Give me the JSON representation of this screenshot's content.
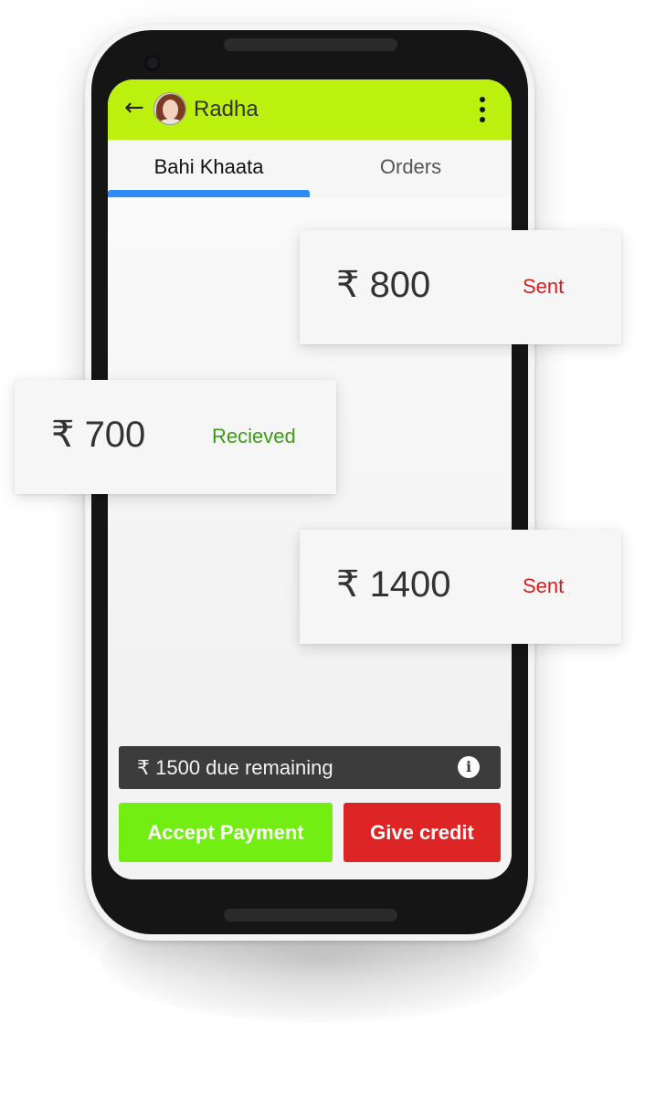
{
  "header": {
    "back_icon": "arrow-left-icon",
    "contact_name": "Radha",
    "menu_icon": "more-vert-icon"
  },
  "tabs": [
    {
      "label": "Bahi Khaata",
      "active": true
    },
    {
      "label": "Orders",
      "active": false
    }
  ],
  "transactions": [
    {
      "amount": "₹ 800",
      "status": "Sent",
      "status_color": "#d21f1f"
    },
    {
      "amount": "₹ 700",
      "status": "Recieved",
      "status_color": "#3f9a1a"
    },
    {
      "amount": "₹ 1400",
      "status": "Sent",
      "status_color": "#d21f1f"
    }
  ],
  "due": {
    "text": "₹ 1500 due remaining",
    "info_icon": "info-icon"
  },
  "actions": {
    "accept_label": "Accept Payment",
    "credit_label": "Give credit"
  },
  "colors": {
    "appbar": "#bbf00f",
    "tab_indicator": "#2f8cf5",
    "accept": "#73ee12",
    "credit": "#dd2525",
    "due_bar": "#3c3c3c"
  }
}
